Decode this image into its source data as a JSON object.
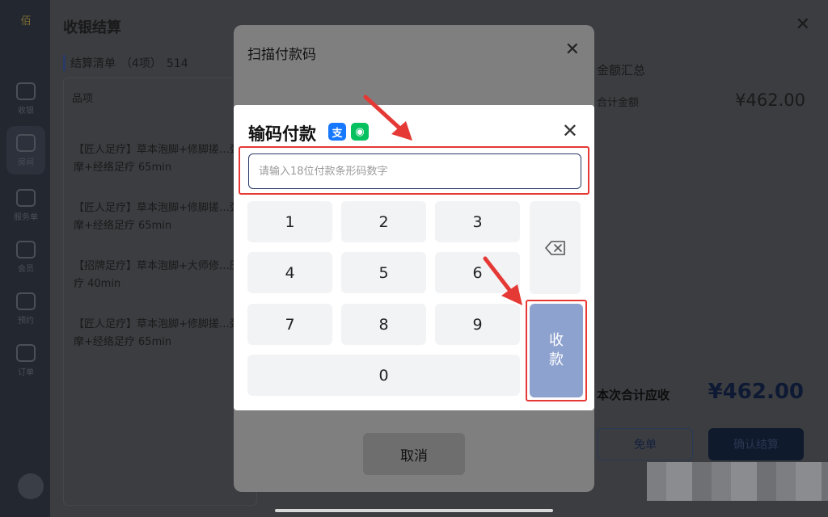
{
  "rail": {
    "logo_text": "佰",
    "items": [
      {
        "label": "收银",
        "icon": "tv-icon"
      },
      {
        "label": "房间",
        "icon": "home-icon"
      },
      {
        "label": "服务单",
        "icon": "calendar-icon"
      },
      {
        "label": "会员",
        "icon": "user-icon"
      },
      {
        "label": "预约",
        "icon": "calendar-icon"
      },
      {
        "label": "订单",
        "icon": "list-icon"
      }
    ]
  },
  "page": {
    "title": "收银结算",
    "list_heading": "结算清单",
    "list_count": "（4项）",
    "list_total": "514",
    "column_item": "品项",
    "items": [
      "【匠人足疗】草本泡脚+修脚搓…颈按摩+经络足疗 65min",
      "【匠人足疗】草本泡脚+修脚搓…颈按摩+经络足疗 65min",
      "【招牌足疗】草本泡脚+大师修…压足疗 40min",
      "【匠人足疗】草本泡脚+修脚搓…颈按摩+经络足疗 65min"
    ],
    "summary_title": "金额汇总",
    "summary_label": "合计金额",
    "summary_value": "¥462.00",
    "due_label": "本次合计应收",
    "due_value": "¥462.00",
    "free_button": "免单",
    "confirm_button": "确认结算"
  },
  "scan_modal": {
    "title": "扫描付款码",
    "cancel_button": "取消"
  },
  "code_modal": {
    "title": "输码付款",
    "alipay_glyph": "支",
    "wechat_glyph": "◉",
    "input_placeholder": "请输入18位付款条形码数字",
    "input_value": "",
    "keys": [
      "1",
      "2",
      "3",
      "4",
      "5",
      "6",
      "7",
      "8",
      "9",
      "0"
    ],
    "collect_button": "收款"
  },
  "colors": {
    "highlight": "#e53935",
    "collect_button": "#8ea2cf",
    "accent_dark": "#2a3a66"
  }
}
